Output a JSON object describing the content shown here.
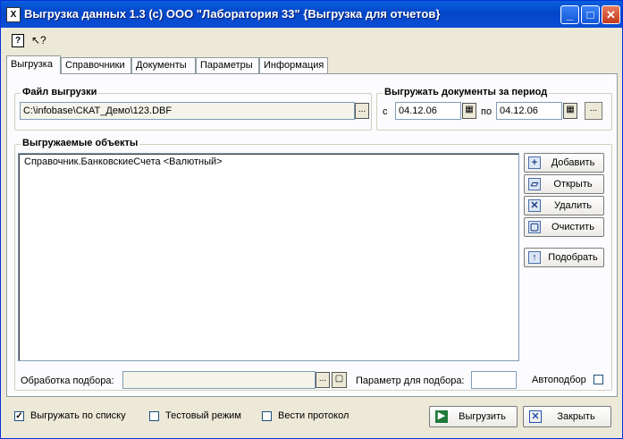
{
  "window": {
    "title": "Выгрузка данных 1.3 (c) ООО \"Лаборатория 33\" {Выгрузка для отчетов}",
    "icon_glyph": "X",
    "minimize_glyph": "_",
    "maximize_glyph": "□",
    "close_glyph": "✕"
  },
  "toolbar": {
    "help_glyph": "?",
    "context_help_glyph": "↖?"
  },
  "tabs": [
    "Выгрузка",
    "Справочники",
    "Документы",
    "Параметры",
    "Информация"
  ],
  "file_group": {
    "title": "Файл выгрузки",
    "path": "C:\\infobase\\СКАТ_Демо\\123.DBF",
    "browse_glyph": "..."
  },
  "period_group": {
    "title": "Выгружать документы за период",
    "from_label": "с",
    "from_date": "04.12.06",
    "to_label": "по",
    "to_date": "04.12.06",
    "calendar_glyph": "▦",
    "more_glyph": "..."
  },
  "objects_group": {
    "title": "Выгружаемые объекты",
    "items": [
      "Справочник.БанковскиеСчета <Валютный>"
    ]
  },
  "actions": [
    {
      "label": "Добавить",
      "glyph": "+"
    },
    {
      "label": "Открыть",
      "glyph": "▱"
    },
    {
      "label": "Удалить",
      "glyph": "✕"
    },
    {
      "label": "Очистить",
      "glyph": "▢"
    },
    {
      "label": "Подобрать",
      "glyph": "↑"
    }
  ],
  "selection": {
    "processing_label": "Обработка подбора:",
    "processing_value": "",
    "browse_glyph": "...",
    "param_label": "Параметр для подбора:",
    "param_value": "",
    "auto_label": "Автоподбор"
  },
  "bottom": {
    "by_list_label": "Выгружать по списку",
    "by_list_checked": true,
    "test_mode_label": "Тестовый режим",
    "test_mode_checked": false,
    "log_label": "Вести протокол",
    "log_checked": false,
    "export_label": "Выгрузить",
    "close_label": "Закрыть",
    "check_glyph": "✓"
  }
}
